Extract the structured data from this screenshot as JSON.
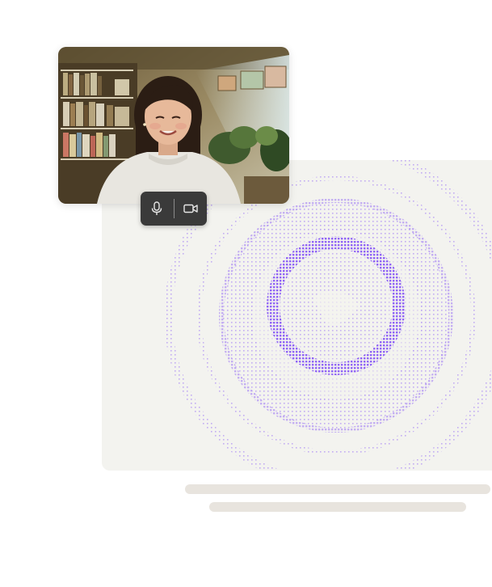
{
  "call": {
    "microphone_button": {
      "icon": "microphone-icon",
      "state": "on"
    },
    "camera_button": {
      "icon": "video-camera-icon",
      "state": "on"
    }
  },
  "colors": {
    "orb_accent": "#8b5cf6",
    "panel_background": "#f3f3ef",
    "controls_background": "#3a3a3a",
    "placeholder_line": "#e8e4de"
  }
}
